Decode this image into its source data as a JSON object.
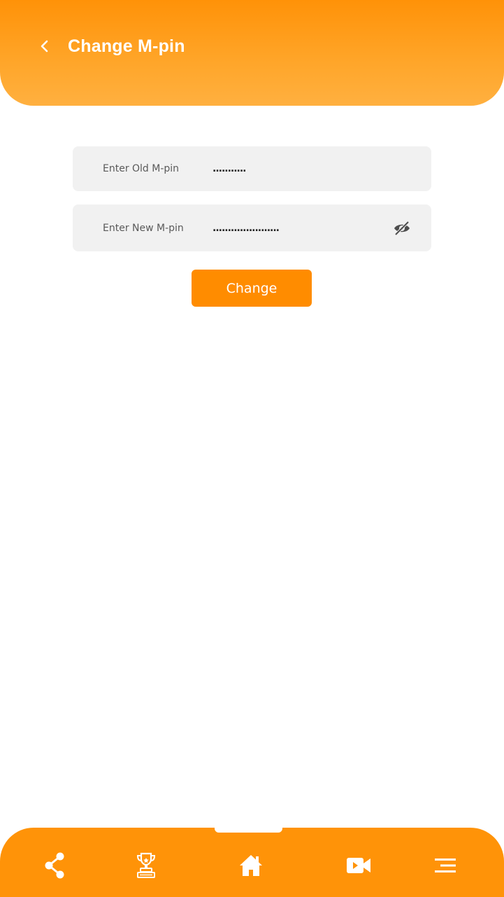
{
  "header": {
    "title": "Change M-pin",
    "back_icon": "chevron-left-icon"
  },
  "form": {
    "old_pin": {
      "label": "Enter Old M-pin",
      "value": "..........."
    },
    "new_pin": {
      "label": "Enter New M-pin",
      "value": "......................",
      "toggle_icon": "eye-off-icon"
    },
    "submit_label": "Change"
  },
  "bottom_nav": {
    "items": [
      {
        "icon": "share-icon"
      },
      {
        "icon": "trophy-icon"
      },
      {
        "icon": "home-icon"
      },
      {
        "icon": "video-icon"
      },
      {
        "icon": "menu-icon"
      }
    ]
  },
  "colors": {
    "accent": "#ff8c00",
    "field_bg": "#f1f1f1",
    "text_muted": "#5a5a5a"
  }
}
